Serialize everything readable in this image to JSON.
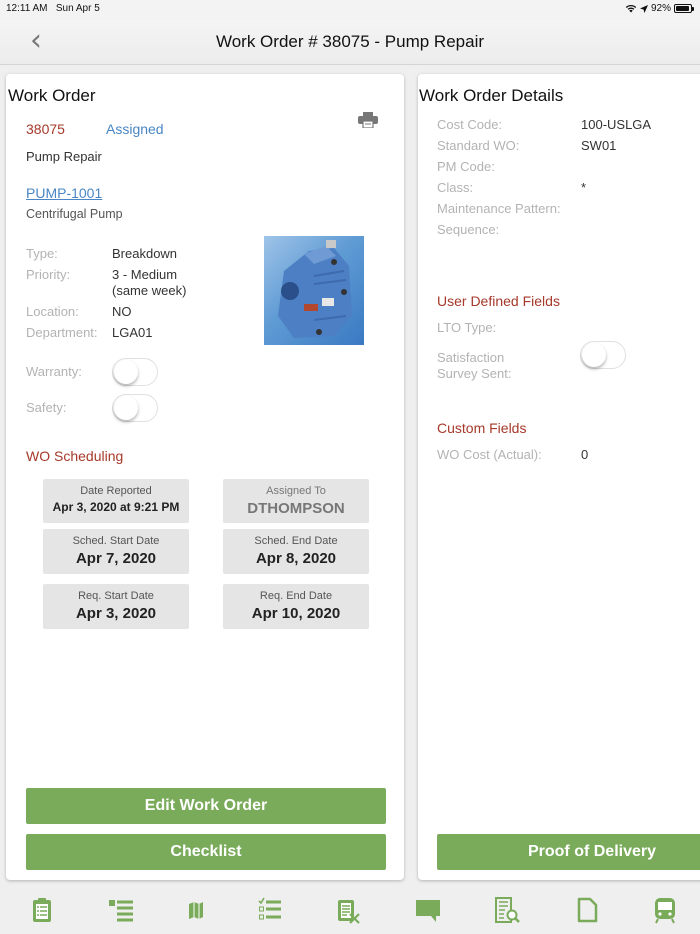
{
  "status_bar": {
    "time": "12:11 AM",
    "date": "Sun Apr 5",
    "battery": "92%",
    "battery_level": 0.92
  },
  "nav": {
    "back_icon": "chevron-left-icon",
    "title": "Work Order # 38075 - Pump Repair"
  },
  "work_order": {
    "title": "Work Order",
    "number": "38075",
    "status": "Assigned",
    "description": "Pump Repair",
    "asset_id": "PUMP-1001",
    "asset_description": "Centrifugal Pump",
    "print_icon": "printer-icon",
    "fields": [
      {
        "label": "Type:",
        "value": "Breakdown"
      },
      {
        "label": "Priority:",
        "value": "3 - Medium (same week)"
      },
      {
        "label": "Location:",
        "value": "NO"
      },
      {
        "label": "Department:",
        "value": "LGA01"
      }
    ],
    "priority_line1": "3 - Medium",
    "priority_line2": "(same week)",
    "toggles": [
      {
        "label": "Warranty:",
        "on": false
      },
      {
        "label": "Safety:",
        "on": false
      }
    ],
    "scheduling_title": "WO Scheduling",
    "scheduling": [
      {
        "label": "Date Reported",
        "value": "Apr 3, 2020 at 9:21 PM"
      },
      {
        "label": "Assigned To",
        "value": "DTHOMPSON"
      },
      {
        "label": "Sched. Start Date",
        "value": "Apr 7, 2020"
      },
      {
        "label": "Sched. End Date",
        "value": "Apr 8, 2020"
      },
      {
        "label": "Req. Start Date",
        "value": "Apr 3, 2020"
      },
      {
        "label": "Req. End Date",
        "value": "Apr 10, 2020"
      }
    ],
    "buttons": {
      "edit": "Edit Work Order",
      "checklist": "Checklist"
    }
  },
  "details": {
    "title": "Work Order Details",
    "fields": [
      {
        "label": "Cost Code:",
        "value": "100-USLGA"
      },
      {
        "label": "Standard WO:",
        "value": "SW01"
      },
      {
        "label": "PM Code:",
        "value": ""
      },
      {
        "label": "Class:",
        "value": "*"
      },
      {
        "label": "Maintenance Pattern:",
        "value": ""
      },
      {
        "label": "Sequence:",
        "value": ""
      }
    ],
    "udf_title": "User Defined Fields",
    "lto_label": "LTO Type:",
    "survey_label_1": "Satisfaction",
    "survey_label_2": "Survey Sent:",
    "survey_on": false,
    "custom_title": "Custom Fields",
    "cost_label": "WO Cost (Actual):",
    "cost_value": "0",
    "pod_button": "Proof of Delivery"
  },
  "tabbar": [
    {
      "icon": "clipboard-list-icon"
    },
    {
      "icon": "list-icon"
    },
    {
      "icon": "map-icon"
    },
    {
      "icon": "checklist-icon"
    },
    {
      "icon": "clipboard-cancel-icon"
    },
    {
      "icon": "comment-icon"
    },
    {
      "icon": "document-search-icon"
    },
    {
      "icon": "file-icon"
    },
    {
      "icon": "train-icon"
    }
  ],
  "colors": {
    "accent_green": "#7aab5b",
    "red": "#a6392a",
    "link_blue": "#4a86c5"
  }
}
